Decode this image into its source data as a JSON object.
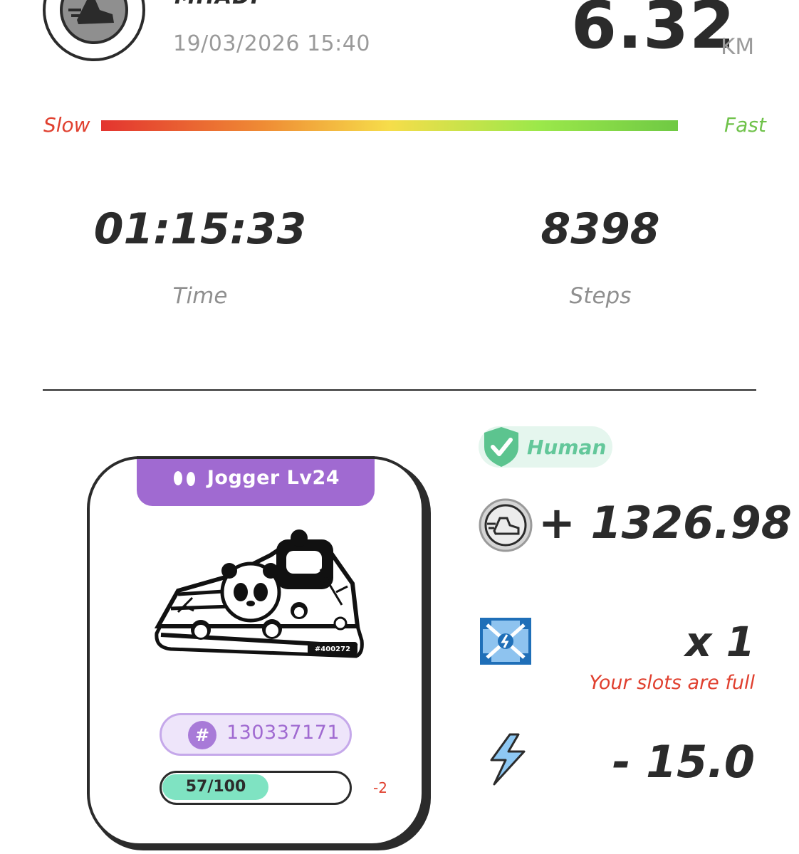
{
  "header": {
    "user_name": "MHADI",
    "date": "19/03/2026 15:40",
    "distance": "6.32",
    "distance_unit": "KM"
  },
  "speed_bar": {
    "slow_label": "Slow",
    "fast_label": "Fast"
  },
  "stats": {
    "time_value": "01:15:33",
    "time_label": "Time",
    "steps_value": "8398",
    "steps_label": "Steps"
  },
  "sneaker_card": {
    "title": "Jogger Lv24",
    "title_icon": "footprints-icon",
    "serial_on_shoe": "#400272",
    "id_number": "130337171",
    "id_symbol": "#",
    "durability_text": "57/100",
    "durability_current": 57,
    "durability_max": 100,
    "durability_change": "-2"
  },
  "rewards": {
    "badge_label": "Human",
    "badge_icon": "shield-check-icon",
    "earned": "+ 1326.98",
    "coin_icon": "running-shoe-coin-icon",
    "box_count": "x 1",
    "box_icon": "mystery-box-icon",
    "box_note": "Your slots are full",
    "energy": "- 15.0",
    "energy_icon": "lightning-icon"
  },
  "colors": {
    "accent_purple": "#a06ad1",
    "slow_red": "#e0402f",
    "fast_green": "#6fc24a",
    "human_green": "#63c79a",
    "durability_fill": "#7fe3c2"
  }
}
